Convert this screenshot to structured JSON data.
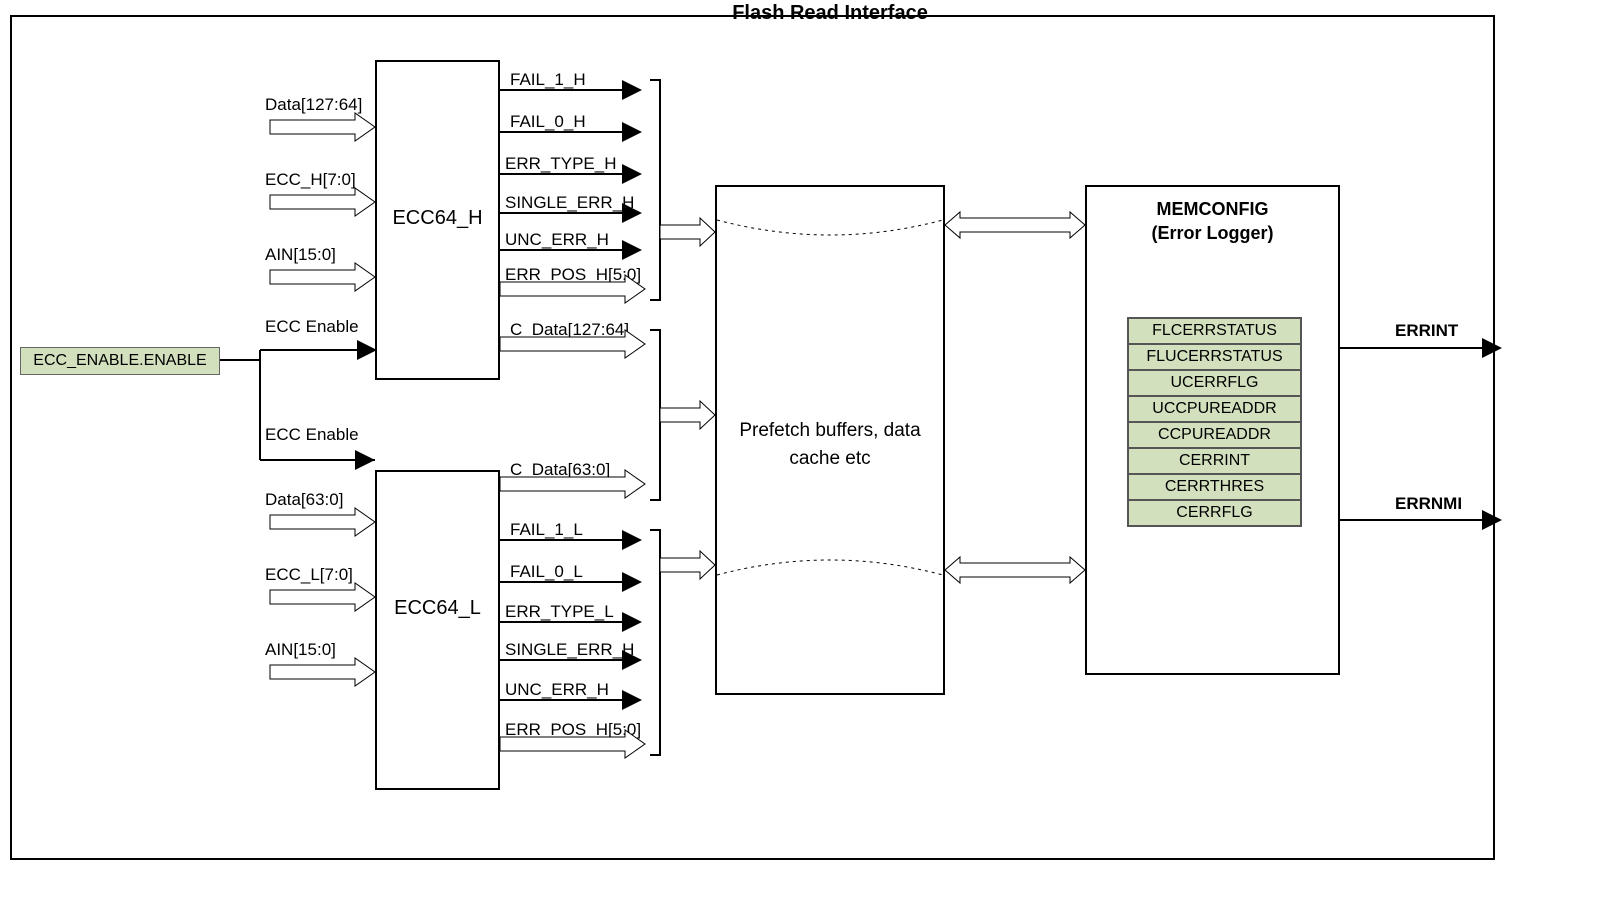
{
  "title": "Flash Read Interface",
  "ecc_enable_reg": "ECC_ENABLE.ENABLE",
  "ecc_enable_label_top": "ECC Enable",
  "ecc_enable_label_bot": "ECC Enable",
  "ecc_h": {
    "name": "ECC64_H",
    "inputs": [
      "Data[127:64]",
      "ECC_H[7:0]",
      "AIN[15:0]"
    ],
    "outputs": [
      "FAIL_1_H",
      "FAIL_0_H",
      "ERR_TYPE_H",
      "SINGLE_ERR_H",
      "UNC_ERR_H",
      "ERR_POS_H[5:0]",
      "C_Data[127:64]"
    ]
  },
  "ecc_l": {
    "name": "ECC64_L",
    "inputs": [
      "Data[63:0]",
      "ECC_L[7:0]",
      "AIN[15:0]"
    ],
    "outputs": [
      "C_Data[63:0]",
      "FAIL_1_L",
      "FAIL_0_L",
      "ERR_TYPE_L",
      "SINGLE_ERR_H",
      "UNC_ERR_H",
      "ERR_POS_H[5:0]"
    ]
  },
  "prefetch_label": "Prefetch buffers, data cache etc",
  "memconfig": {
    "title1": "MEMCONFIG",
    "title2": "(Error Logger)",
    "registers": [
      "FLCERRSTATUS",
      "FLUCERRSTATUS",
      "UCERRFLG",
      "UCCPUREADDR",
      "CCPUREADDR",
      "CERRINT",
      "CERRTHRES",
      "CERRFLG"
    ]
  },
  "outputs": {
    "errint": "ERRINT",
    "errnmi": "ERRNMI"
  }
}
